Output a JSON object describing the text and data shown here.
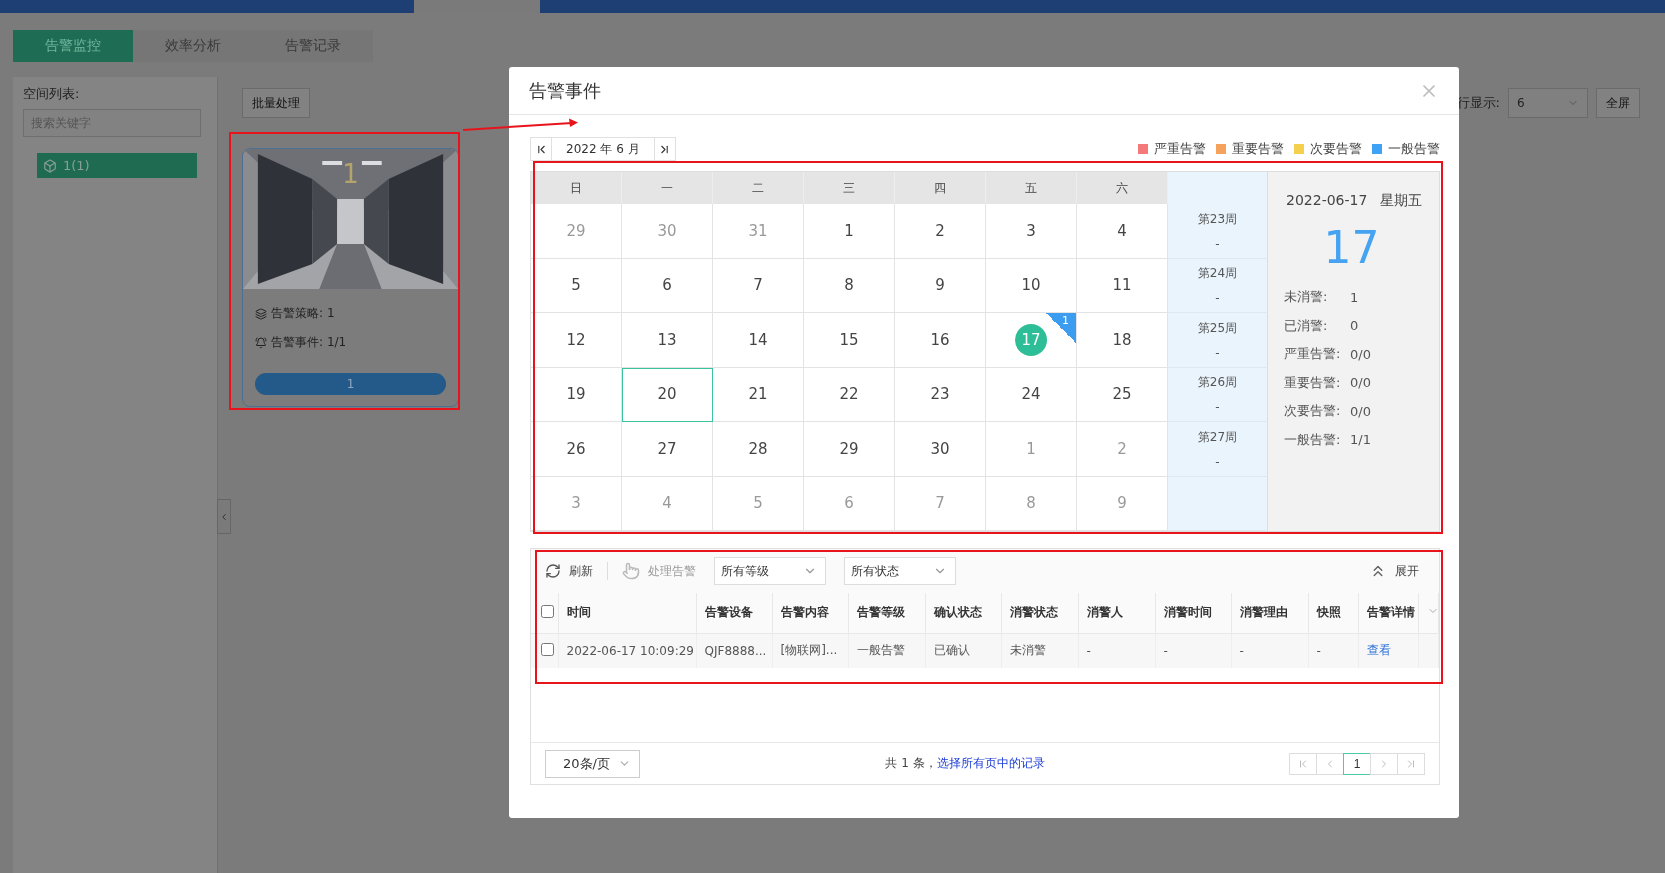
{
  "tabs": [
    {
      "label": "告警监控",
      "selected": true
    },
    {
      "label": "效率分析",
      "selected": false
    },
    {
      "label": "告警记录",
      "selected": false
    }
  ],
  "space_list": {
    "label": "空间列表:",
    "search": {
      "placeholder": "搜索关键字"
    },
    "items": [
      {
        "label": "1(1)",
        "selected": true
      }
    ]
  },
  "toolbar": {
    "batch_button": "批量处理",
    "rows_label": "行显示:",
    "rows_value": "6",
    "fullscreen_button": "全屏"
  },
  "cards": [
    {
      "title": "1",
      "stats": [
        {
          "kind": "strategy",
          "label": "告警策略:",
          "value": "1"
        },
        {
          "kind": "event",
          "label": "告警事件:",
          "value": "1/1"
        }
      ],
      "button": "1"
    }
  ],
  "dialog": {
    "title": "告警事件",
    "month": "2022 年 6 月",
    "legend": [
      {
        "label": "严重告警",
        "color": "#f47a7a"
      },
      {
        "label": "重要告警",
        "color": "#f5a25d"
      },
      {
        "label": "次要告警",
        "color": "#f5d04c"
      },
      {
        "label": "一般告警",
        "color": "#3ea3f5"
      }
    ],
    "weekdays": [
      "日",
      "一",
      "二",
      "三",
      "四",
      "五",
      "六"
    ],
    "weeks": [
      {
        "label": "第23周",
        "value": "-",
        "days": [
          {
            "day": "29",
            "other_month": true
          },
          {
            "day": "30",
            "other_month": true
          },
          {
            "day": "31",
            "other_month": true
          },
          {
            "day": "1",
            "other_month": false
          },
          {
            "day": "2",
            "other_month": false
          },
          {
            "day": "3",
            "other_month": false
          },
          {
            "day": "4",
            "other_month": false
          }
        ]
      },
      {
        "label": "第24周",
        "value": "-",
        "days": [
          {
            "day": "5",
            "other_month": false
          },
          {
            "day": "6",
            "other_month": false
          },
          {
            "day": "7",
            "other_month": false
          },
          {
            "day": "8",
            "other_month": false
          },
          {
            "day": "9",
            "other_month": false
          },
          {
            "day": "10",
            "other_month": false
          },
          {
            "day": "11",
            "other_month": false
          }
        ]
      },
      {
        "label": "第25周",
        "value": "-",
        "days": [
          {
            "day": "12",
            "other_month": false
          },
          {
            "day": "13",
            "other_month": false
          },
          {
            "day": "14",
            "other_month": false
          },
          {
            "day": "15",
            "other_month": false
          },
          {
            "day": "16",
            "other_month": false
          },
          {
            "day": "17",
            "other_month": false,
            "selected": true,
            "badge": "1"
          },
          {
            "day": "18",
            "other_month": false
          }
        ]
      },
      {
        "label": "第26周",
        "value": "-",
        "days": [
          {
            "day": "19",
            "other_month": false
          },
          {
            "day": "20",
            "other_month": false,
            "today": true
          },
          {
            "day": "21",
            "other_month": false
          },
          {
            "day": "22",
            "other_month": false
          },
          {
            "day": "23",
            "other_month": false
          },
          {
            "day": "24",
            "other_month": false
          },
          {
            "day": "25",
            "other_month": false
          }
        ]
      },
      {
        "label": "第27周",
        "value": "-",
        "days": [
          {
            "day": "26",
            "other_month": false
          },
          {
            "day": "27",
            "other_month": false
          },
          {
            "day": "28",
            "other_month": false
          },
          {
            "day": "29",
            "other_month": false
          },
          {
            "day": "30",
            "other_month": false
          },
          {
            "day": "1",
            "other_month": true
          },
          {
            "day": "2",
            "other_month": true
          }
        ]
      },
      {
        "days": [
          {
            "day": "3",
            "other_month": true
          },
          {
            "day": "4",
            "other_month": true
          },
          {
            "day": "5",
            "other_month": true
          },
          {
            "day": "6",
            "other_month": true
          },
          {
            "day": "7",
            "other_month": true
          },
          {
            "day": "8",
            "other_month": true
          },
          {
            "day": "9",
            "other_month": true
          }
        ]
      }
    ],
    "detail": {
      "date": "2022-06-17",
      "weekday": "星期五",
      "day": "17",
      "stats": [
        {
          "label": "未消警:",
          "value": "1"
        },
        {
          "label": "已消警:",
          "value": "0"
        },
        {
          "label": "严重告警:",
          "value": "0/0"
        },
        {
          "label": "重要告警:",
          "value": "0/0"
        },
        {
          "label": "次要告警:",
          "value": "0/0"
        },
        {
          "label": "一般告警:",
          "value": "1/1"
        }
      ]
    },
    "alarm_table": {
      "refresh": "刷新",
      "handle": {
        "label": "处理告警",
        "disabled": true
      },
      "filters": [
        "所有等级",
        "所有状态"
      ],
      "expand": "展开",
      "header_checked": false,
      "columns": [
        "时间",
        "告警设备",
        "告警内容",
        "告警等级",
        "确认状态",
        "消警状态",
        "消警人",
        "消警时间",
        "消警理由",
        "快照",
        "告警详情"
      ],
      "rows": [
        {
          "checked": false,
          "cells": [
            "2022-06-17 10:09:29",
            "QJF8888...",
            "[物联网]...",
            "一般告警",
            "已确认",
            "未消警",
            "-",
            "-",
            "-",
            "-"
          ],
          "link": "查看"
        }
      ]
    },
    "pagination": {
      "page_size": "20条/页",
      "summary": "共 1 条，",
      "select_all": "选择所有页中的记录",
      "pages": [
        {
          "label": "1",
          "selected": true
        }
      ]
    }
  }
}
